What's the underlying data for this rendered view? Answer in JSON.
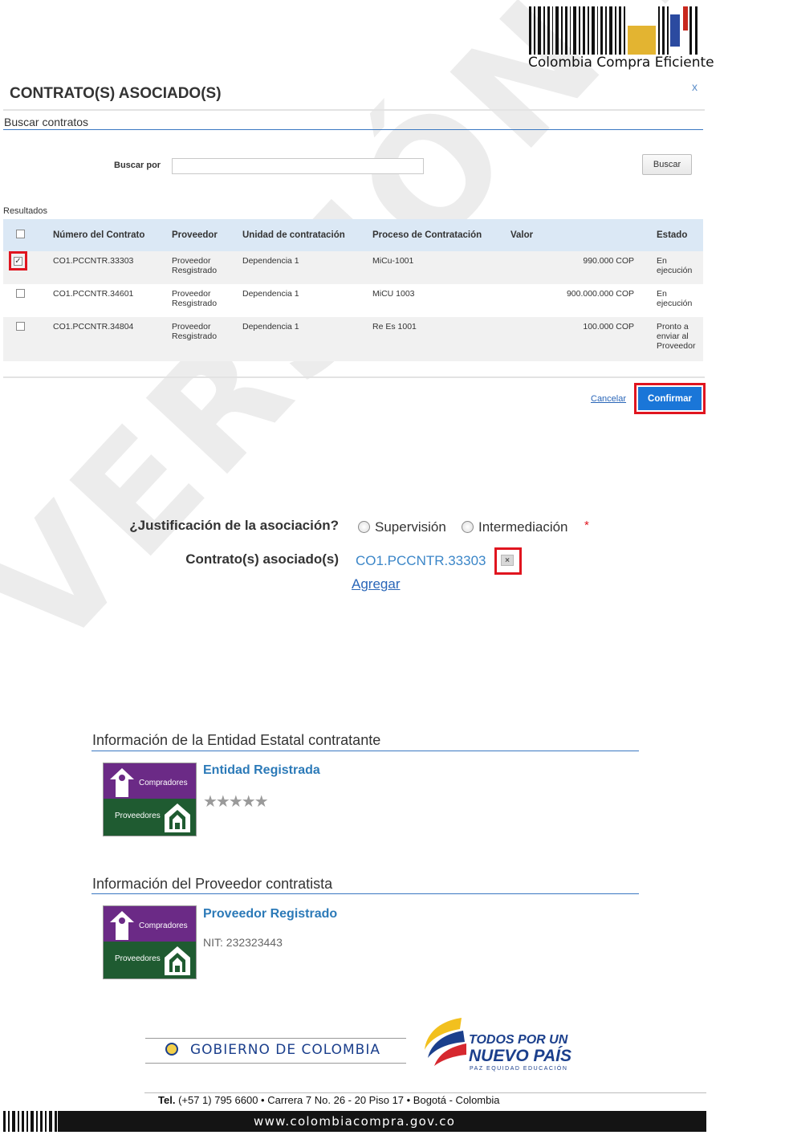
{
  "header": {
    "brand": "Colombia Compra Eficiente"
  },
  "dialog": {
    "title": "CONTRATO(S) ASOCIADO(S)",
    "close_label": "x",
    "section_title": "Buscar contratos",
    "search_label": "Buscar por",
    "search_value": "",
    "search_button": "Buscar",
    "results_label": "Resultados",
    "columns": [
      "Número del Contrato",
      "Proveedor",
      "Unidad de contratación",
      "Proceso de Contratación",
      "Valor",
      "Estado"
    ],
    "rows": [
      {
        "checked": true,
        "numero": "CO1.PCCNTR.33303",
        "proveedor": [
          "Proveedor",
          "Resgistrado"
        ],
        "unidad": "Dependencia 1",
        "proceso": "MiCu-1001",
        "valor": "990.000 COP",
        "estado": [
          "En",
          "ejecución"
        ]
      },
      {
        "checked": false,
        "numero": "CO1.PCCNTR.34601",
        "proveedor": [
          "Proveedor",
          "Resgistrado"
        ],
        "unidad": "Dependencia 1",
        "proceso": "MiCU 1003",
        "valor": "900.000.000 COP",
        "estado": [
          "En",
          "ejecución"
        ]
      },
      {
        "checked": false,
        "numero": "CO1.PCCNTR.34804",
        "proveedor": [
          "Proveedor",
          "Resgistrado"
        ],
        "unidad": "Dependencia 1",
        "proceso": "Re Es 1001",
        "valor": "100.000 COP",
        "estado": [
          "Pronto a",
          "enviar al",
          "Proveedor"
        ]
      }
    ],
    "cancel_label": "Cancelar",
    "confirm_label": "Confirmar"
  },
  "association": {
    "justification_label": "¿Justificación de la asociación?",
    "options": [
      "Supervisión",
      "Intermediación"
    ],
    "required_mark": "*",
    "contracts_label": "Contrato(s) asociado(s)",
    "contract_value": "CO1.PCCNTR.33303",
    "remove_label": "×",
    "add_label": "Agregar"
  },
  "entity_section": {
    "title": "Información de la Entidad Estatal contratante",
    "badge_top": "Compradores",
    "badge_bottom": "Proveedores",
    "name": "Entidad Registrada",
    "rating_stars": 5,
    "stars_text": "★★★★★"
  },
  "supplier_section": {
    "title": "Información del Proveedor contratista",
    "badge_top": "Compradores",
    "badge_bottom": "Proveedores",
    "name": "Proveedor Registrado",
    "nit": "NIT: 232323443"
  },
  "footer": {
    "gov": "GOBIERNO DE COLOMBIA",
    "campaign_line1": "TODOS POR UN",
    "campaign_line2": "NUEVO PAÍS",
    "campaign_line3": "PAZ  EQUIDAD  EDUCACIÓN",
    "tel_bold": "Tel.",
    "tel_text": "(+57 1) 795 6600 • Carrera 7 No. 26 - 20 Piso 17 • Bogotá - Colombia",
    "website": "www.colombiacompra.gov.co"
  },
  "watermark": "VERSIÓN PRELIMINAR",
  "colors": {
    "accent": "#1a76d8",
    "highlight": "#e0151f",
    "link": "#2a66b8",
    "compradores": "#6b2a86",
    "proveedores": "#1f5b31"
  }
}
